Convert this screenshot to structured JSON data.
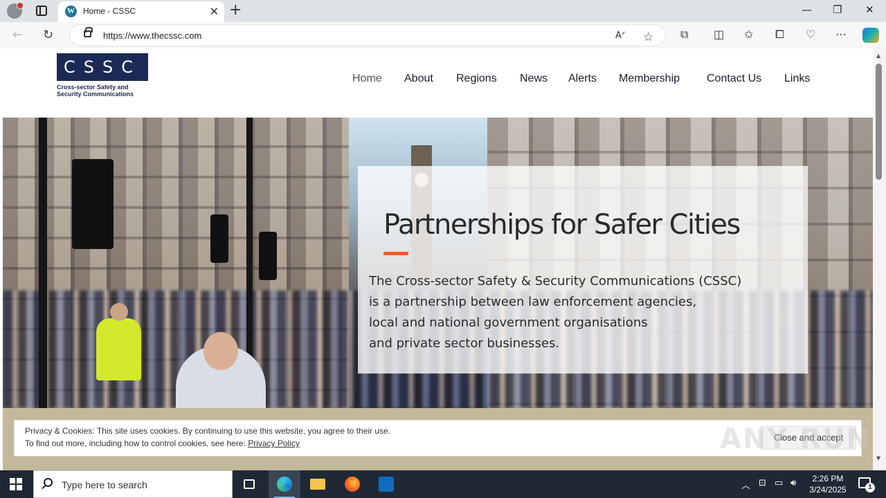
{
  "browser": {
    "tab_title": "Home - CSSC",
    "tab_favicon": "W",
    "url": "https://www.thecssc.com",
    "new_tab": "+",
    "minimize": "—",
    "restore": "❐",
    "close": "✕",
    "tab_close": "✕"
  },
  "site": {
    "logo_letters": "CSSC",
    "logo_subtitle_1": "Cross-sector Safety and",
    "logo_subtitle_2": "Security Communications",
    "nav": [
      {
        "label": "Home"
      },
      {
        "label": "About"
      },
      {
        "label": "Regions"
      },
      {
        "label": "News"
      },
      {
        "label": "Alerts"
      },
      {
        "label": "Membership"
      },
      {
        "label": "Contact Us"
      },
      {
        "label": "Links"
      }
    ],
    "hero": {
      "heading": "Partnerships for Safer Cities",
      "intro_lines": [
        "The Cross-sector Safety & Security Communications (CSSC)",
        "is a partnership between law enforcement agencies,",
        "local and national government organisations",
        "and private sector businesses."
      ],
      "accent_color": "#ee5a24"
    },
    "cookie": {
      "line1": "Privacy & Cookies: This site uses cookies. By continuing to use this website, you agree to their use.",
      "line2_prefix": "To find out more, including how to control cookies, see here: ",
      "line2_link": "Privacy Policy",
      "button": "Close and accept"
    }
  },
  "taskbar": {
    "search_placeholder": "Type here to search",
    "time": "2:26 PM",
    "date": "3/24/2025",
    "notification_count": "1"
  },
  "watermark": "ANY RUN"
}
